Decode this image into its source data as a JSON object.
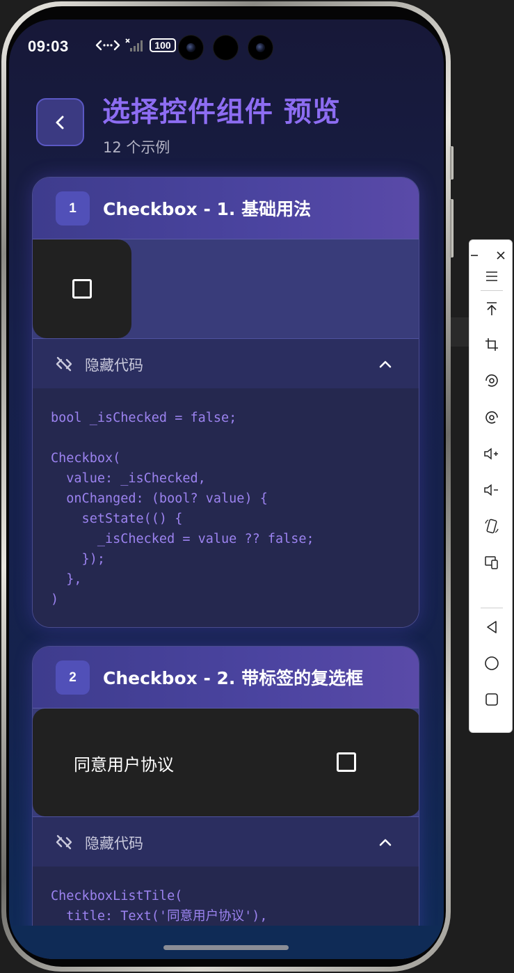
{
  "status_bar": {
    "time": "09:03",
    "battery": "100",
    "icons": [
      "data-transfer-icon",
      "no-signal-icon",
      "battery-icon"
    ]
  },
  "header": {
    "back_icon": "chevron-left-icon",
    "title": "选择控件组件 预览",
    "subtitle": "12 个示例"
  },
  "cards": [
    {
      "index": "1",
      "title": "Checkbox - 1. 基础用法",
      "toggle_label": "隐藏代码",
      "code": "bool _isChecked = false;\n\nCheckbox(\n  value: _isChecked,\n  onChanged: (bool? value) {\n    setState(() {\n      _isChecked = value ?? false;\n    });\n  },\n)"
    },
    {
      "index": "2",
      "title": "Checkbox - 2. 带标签的复选框",
      "preview_label": "同意用户协议",
      "toggle_label": "隐藏代码",
      "code": "CheckboxListTile(\n  title: Text('同意用户协议'),"
    }
  ],
  "colors": {
    "accent": "#8d6df2",
    "card_header": "#4b44a0",
    "code_text": "#9c83f0",
    "badge": "#5150b8"
  },
  "toolbar": {
    "items": [
      "minimize-icon",
      "close-icon",
      "menu-icon",
      "pin-top-icon",
      "crop-icon",
      "screen-record-icon",
      "screenshot-icon",
      "volume-up-icon",
      "volume-down-icon",
      "rotate-icon",
      "multi-device-icon",
      "back-nav-icon",
      "home-nav-icon",
      "recents-nav-icon"
    ]
  }
}
